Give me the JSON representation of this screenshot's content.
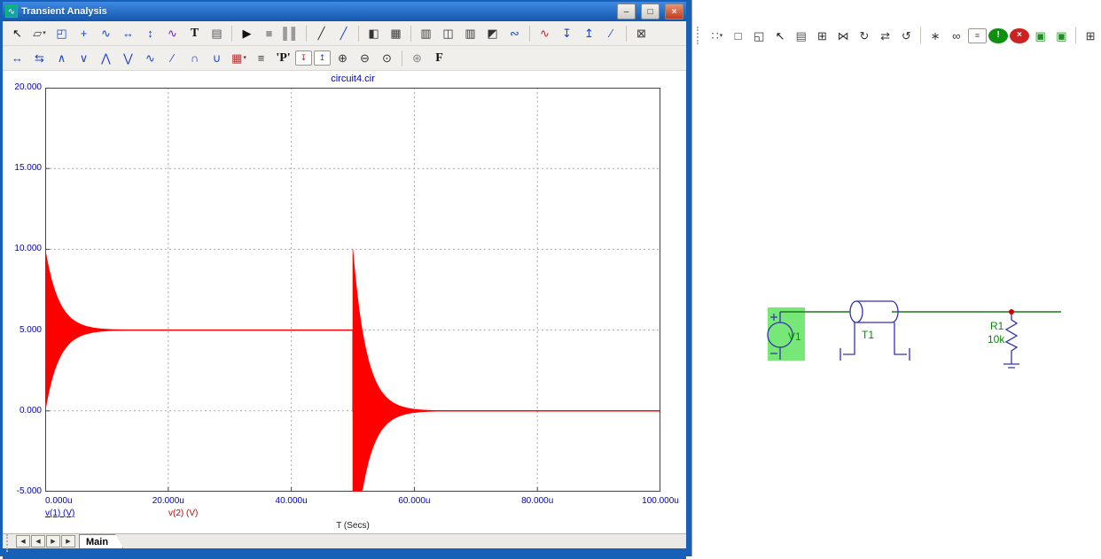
{
  "window": {
    "title": "Transient Analysis",
    "icon": "∿",
    "controls": {
      "minimize": "–",
      "maximize": "□",
      "close": "×"
    }
  },
  "toolbar1": {
    "items": [
      {
        "name": "select-pointer-icon",
        "glyph": "↖",
        "color": "#111111"
      },
      {
        "name": "graphics-menu-icon",
        "glyph": "▱",
        "color": "#444444",
        "dd": true
      },
      {
        "name": "scale-mode-icon",
        "glyph": "◰",
        "color": "#1a46c8"
      },
      {
        "name": "cursor-mode-icon",
        "glyph": "+",
        "color": "#1a46c8"
      },
      {
        "name": "point-tag-icon",
        "glyph": "∿",
        "color": "#1a46c8"
      },
      {
        "name": "horizontal-tag-icon",
        "glyph": "↔",
        "color": "#1a46c8"
      },
      {
        "name": "vertical-tag-icon",
        "glyph": "↕",
        "color": "#1a46c8"
      },
      {
        "name": "performance-tag-icon",
        "glyph": "∿",
        "color": "#7a1ac8"
      },
      {
        "name": "text-tool-icon",
        "glyph": "T",
        "color": "#111111",
        "serif": true
      },
      {
        "name": "properties-icon",
        "glyph": "▤",
        "color": "#555555"
      },
      {
        "sep": true
      },
      {
        "name": "run-button",
        "glyph": "▶",
        "color": "#111111"
      },
      {
        "name": "stop-button",
        "glyph": "■",
        "color": "#9b9b9b"
      },
      {
        "name": "pause-button",
        "glyph": "▌▌",
        "color": "#9b9b9b"
      },
      {
        "sep": true
      },
      {
        "name": "line-tool-icon",
        "glyph": "╱",
        "color": "#333333"
      },
      {
        "name": "measure-line-icon",
        "glyph": "╱",
        "color": "#1a46c8"
      },
      {
        "sep": true
      },
      {
        "name": "split-panel-icon",
        "glyph": "◧",
        "color": "#333333"
      },
      {
        "name": "grid-panel-icon",
        "glyph": "▦",
        "color": "#333333"
      },
      {
        "sep": true
      },
      {
        "name": "stripe-panel-icon",
        "glyph": "▥",
        "color": "#333333"
      },
      {
        "name": "left-panel-icon",
        "glyph": "◫",
        "color": "#333333"
      },
      {
        "name": "column-panel-icon",
        "glyph": "▥",
        "color": "#333333"
      },
      {
        "name": "bottom-panel-icon",
        "glyph": "◩",
        "color": "#333333"
      },
      {
        "name": "waveform-cut-icon",
        "glyph": "∾",
        "color": "#1a46c8"
      },
      {
        "sep": true
      },
      {
        "name": "tag-waveform-icon",
        "glyph": "∿",
        "color": "#c22222"
      },
      {
        "name": "drop-cursor-icon",
        "glyph": "↧",
        "color": "#1a46c8"
      },
      {
        "name": "raise-cursor-icon",
        "glyph": "↥",
        "color": "#1a46c8"
      },
      {
        "name": "slope-icon",
        "glyph": "∕",
        "color": "#1a46c8"
      },
      {
        "sep": true
      },
      {
        "name": "xy-axes-icon",
        "glyph": "⊠",
        "color": "#333333"
      }
    ]
  },
  "toolbar2": {
    "items": [
      {
        "name": "cursor-left-icon",
        "glyph": "↔",
        "color": "#1a46c8"
      },
      {
        "name": "cursor-right-icon",
        "glyph": "⇆",
        "color": "#1a46c8"
      },
      {
        "name": "next-peak-icon",
        "glyph": "∧",
        "color": "#1a46c8"
      },
      {
        "name": "next-valley-icon",
        "glyph": "∨",
        "color": "#1a46c8"
      },
      {
        "name": "global-high-icon",
        "glyph": "⋀",
        "color": "#1a46c8"
      },
      {
        "name": "global-low-icon",
        "glyph": "⋁",
        "color": "#1a46c8"
      },
      {
        "name": "inflection-icon",
        "glyph": "∿",
        "color": "#1a46c8"
      },
      {
        "name": "slope-cursor-icon",
        "glyph": "∕",
        "color": "#1a46c8"
      },
      {
        "name": "top-cursor-icon",
        "glyph": "∩",
        "color": "#1a46c8"
      },
      {
        "name": "bottom-cursor-icon",
        "glyph": "∪",
        "color": "#1a46c8"
      },
      {
        "name": "palette-icon",
        "glyph": "▦",
        "color": "#c03030",
        "dd": true
      },
      {
        "name": "numeric-output-icon",
        "glyph": "≡",
        "color": "#333333"
      },
      {
        "name": "p-key-icon",
        "glyph": "'P'",
        "color": "#111111",
        "serif": true
      },
      {
        "name": "tag-point-icon",
        "glyph": "↧",
        "color": "#c22222",
        "boxed": true
      },
      {
        "name": "tag-horizontal-icon",
        "glyph": "↥",
        "color": "#1a46c8",
        "boxed": true
      },
      {
        "name": "zoom-in-icon",
        "glyph": "⊕",
        "color": "#333333"
      },
      {
        "name": "zoom-out-icon",
        "glyph": "⊖",
        "color": "#333333"
      },
      {
        "name": "zoom-window-icon",
        "glyph": "⊙",
        "color": "#333333"
      },
      {
        "sep": true
      },
      {
        "name": "web-icon",
        "glyph": "⊛",
        "color": "#888888"
      },
      {
        "name": "fourier-icon",
        "glyph": "F",
        "color": "#111111",
        "serif": true
      }
    ]
  },
  "schematic_toolbar": {
    "items": [
      {
        "grip": true
      },
      {
        "name": "grid-options-icon",
        "glyph": "∷",
        "color": "#555555",
        "dd": true
      },
      {
        "name": "rectangle-tool-icon",
        "glyph": "□",
        "color": "#333333"
      },
      {
        "name": "region-tool-icon",
        "glyph": "◱",
        "color": "#333333"
      },
      {
        "name": "select-tool-icon",
        "glyph": "↖",
        "color": "#111111"
      },
      {
        "name": "properties-icon",
        "glyph": "▤",
        "color": "#555555"
      },
      {
        "name": "component-icon",
        "glyph": "⊞",
        "color": "#333333"
      },
      {
        "name": "mirror-icon",
        "glyph": "⋈",
        "color": "#333333"
      },
      {
        "name": "rotate-cw-icon",
        "glyph": "↻",
        "color": "#333333"
      },
      {
        "name": "flip-icon",
        "glyph": "⇄",
        "color": "#333333"
      },
      {
        "name": "rotate-ccw-icon",
        "glyph": "↺",
        "color": "#333333"
      },
      {
        "sep": true
      },
      {
        "name": "probe-icon",
        "glyph": "∗",
        "color": "#444444"
      },
      {
        "name": "find-binoculars-icon",
        "glyph": "∞",
        "color": "#333333"
      },
      {
        "name": "comment-icon",
        "glyph": "≡",
        "color": "#555555",
        "boxed": true
      },
      {
        "name": "info-icon",
        "glyph": "!",
        "color": "#ffffff",
        "circle": "#0f8f0f"
      },
      {
        "name": "clear-errors-icon",
        "glyph": "×",
        "color": "#ffffff",
        "circle": "#cc2222"
      },
      {
        "name": "copy-to-front-icon",
        "glyph": "▣",
        "color": "#1f8f1f"
      },
      {
        "name": "copy-to-back-icon",
        "glyph": "▣",
        "color": "#1f8f1f"
      },
      {
        "sep": true
      },
      {
        "name": "new-window-icon",
        "glyph": "⊞",
        "color": "#333333"
      }
    ]
  },
  "chart_data": {
    "type": "line",
    "title": "circuit4.cir",
    "xlabel": "T (Secs)",
    "xlim": [
      0,
      100
    ],
    "ylim": [
      -5,
      20
    ],
    "grid": true,
    "legend_position": "bottom",
    "x_tick_pos": [
      0,
      20,
      40,
      60,
      80,
      100
    ],
    "x_tick_labels": [
      "0.000u",
      "20.000u",
      "40.000u",
      "60.000u",
      "80.000u",
      "100.000u"
    ],
    "y_tick_pos": [
      20,
      15,
      10,
      5,
      0,
      -5
    ],
    "y_tick_labels": [
      "20.000",
      "15.000",
      "10.000",
      "5.000",
      "0.000",
      "-5.000"
    ],
    "series": [
      {
        "name": "v(1) (V)",
        "color": "#0000dd",
        "legend_underline": true,
        "points": [
          [
            0,
            5
          ],
          [
            50,
            5
          ],
          [
            50,
            0
          ],
          [
            100,
            0
          ]
        ]
      },
      {
        "name": "v(2) (V)",
        "color": "#ff0000",
        "flat": [
          [
            0,
            50,
            5
          ],
          [
            50,
            100,
            0
          ]
        ],
        "rings": [
          {
            "t0": 0,
            "level": 5,
            "amplitude": 5,
            "tau": 2.2,
            "duration": 13
          },
          {
            "t0": 50,
            "level": 0,
            "amplitude": 10,
            "tau": 2.2,
            "duration": 15
          }
        ]
      }
    ]
  },
  "bottom_nav": {
    "tab": "Main",
    "buttons": [
      {
        "grip": true
      },
      {
        "name": "plot-scroll-start-button",
        "glyph": "◀",
        "cls": "nav-btn"
      },
      {
        "name": "plot-scroll-left-button",
        "glyph": "◀",
        "cls": "nav-btn"
      },
      {
        "name": "plot-scroll-right-button",
        "glyph": "▶",
        "cls": "nav-btn"
      },
      {
        "name": "plot-scroll-end-button",
        "glyph": "▶",
        "cls": "nav-btn"
      }
    ]
  },
  "schematic": {
    "components": [
      {
        "ref": "V1",
        "type": "voltage-source",
        "selected": true
      },
      {
        "ref": "T1",
        "type": "transmission-line"
      },
      {
        "ref": "R1",
        "type": "resistor",
        "value": "10k"
      }
    ],
    "colors": {
      "wire": "#1a7a1a",
      "component": "#3333b0",
      "label": "#0a8a0a",
      "highlight": "#77e877",
      "junction": "#cc0000"
    }
  }
}
